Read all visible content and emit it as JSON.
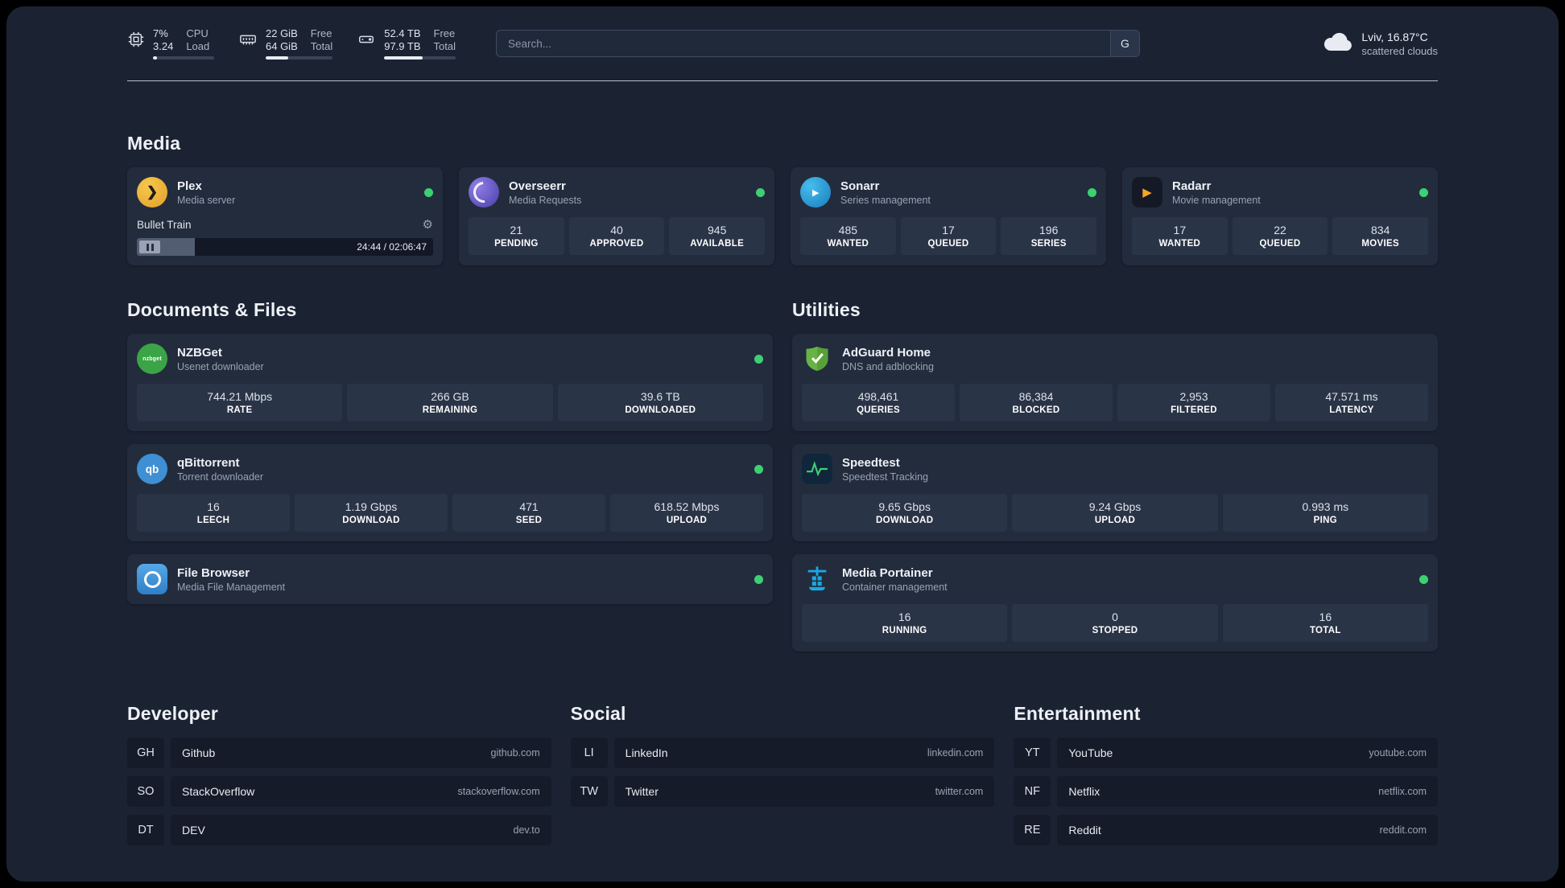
{
  "topbar": {
    "cpu": {
      "value_top": "7%",
      "value_bottom": "3.24",
      "label_top": "CPU",
      "label_bottom": "Load",
      "bar_percent": 7
    },
    "ram": {
      "value_top": "22 GiB",
      "value_bottom": "64 GiB",
      "label_top": "Free",
      "label_bottom": "Total",
      "bar_percent": 34
    },
    "disk": {
      "value_top": "52.4 TB",
      "value_bottom": "97.9 TB",
      "label_top": "Free",
      "label_bottom": "Total",
      "bar_percent": 54
    },
    "search": {
      "placeholder": "Search...",
      "engine_label": "G"
    },
    "weather": {
      "location": "Lviv, 16.87°C",
      "condition": "scattered clouds"
    }
  },
  "sections": {
    "media": {
      "title": "Media",
      "plex": {
        "name": "Plex",
        "subtitle": "Media server",
        "now_playing": {
          "title": "Bullet Train",
          "time": "24:44 / 02:06:47",
          "progress_percent": 19.5
        }
      },
      "overseerr": {
        "name": "Overseerr",
        "subtitle": "Media Requests",
        "stats": [
          {
            "value": "21",
            "label": "PENDING"
          },
          {
            "value": "40",
            "label": "APPROVED"
          },
          {
            "value": "945",
            "label": "AVAILABLE"
          }
        ]
      },
      "sonarr": {
        "name": "Sonarr",
        "subtitle": "Series management",
        "stats": [
          {
            "value": "485",
            "label": "WANTED"
          },
          {
            "value": "17",
            "label": "QUEUED"
          },
          {
            "value": "196",
            "label": "SERIES"
          }
        ]
      },
      "radarr": {
        "name": "Radarr",
        "subtitle": "Movie management",
        "stats": [
          {
            "value": "17",
            "label": "WANTED"
          },
          {
            "value": "22",
            "label": "QUEUED"
          },
          {
            "value": "834",
            "label": "MOVIES"
          }
        ]
      }
    },
    "documents": {
      "title": "Documents & Files",
      "nzbget": {
        "name": "NZBGet",
        "subtitle": "Usenet downloader",
        "icon_text": "nzbget",
        "stats": [
          {
            "value": "744.21 Mbps",
            "label": "RATE"
          },
          {
            "value": "266 GB",
            "label": "REMAINING"
          },
          {
            "value": "39.6 TB",
            "label": "DOWNLOADED"
          }
        ]
      },
      "qbittorrent": {
        "name": "qBittorrent",
        "subtitle": "Torrent downloader",
        "icon_text": "qb",
        "stats": [
          {
            "value": "16",
            "label": "LEECH"
          },
          {
            "value": "1.19 Gbps",
            "label": "DOWNLOAD"
          },
          {
            "value": "471",
            "label": "SEED"
          },
          {
            "value": "618.52 Mbps",
            "label": "UPLOAD"
          }
        ]
      },
      "filebrowser": {
        "name": "File Browser",
        "subtitle": "Media File Management"
      }
    },
    "utilities": {
      "title": "Utilities",
      "adguard": {
        "name": "AdGuard Home",
        "subtitle": "DNS and adblocking",
        "stats": [
          {
            "value": "498,461",
            "label": "QUERIES"
          },
          {
            "value": "86,384",
            "label": "BLOCKED"
          },
          {
            "value": "2,953",
            "label": "FILTERED"
          },
          {
            "value": "47.571 ms",
            "label": "LATENCY"
          }
        ]
      },
      "speedtest": {
        "name": "Speedtest",
        "subtitle": "Speedtest Tracking",
        "stats": [
          {
            "value": "9.65 Gbps",
            "label": "DOWNLOAD"
          },
          {
            "value": "9.24 Gbps",
            "label": "UPLOAD"
          },
          {
            "value": "0.993 ms",
            "label": "PING"
          }
        ]
      },
      "portainer": {
        "name": "Media Portainer",
        "subtitle": "Container management",
        "stats": [
          {
            "value": "16",
            "label": "RUNNING"
          },
          {
            "value": "0",
            "label": "STOPPED"
          },
          {
            "value": "16",
            "label": "TOTAL"
          }
        ]
      }
    },
    "bookmarks": [
      {
        "title": "Developer",
        "items": [
          {
            "abbr": "GH",
            "name": "Github",
            "url": "github.com"
          },
          {
            "abbr": "SO",
            "name": "StackOverflow",
            "url": "stackoverflow.com"
          },
          {
            "abbr": "DT",
            "name": "DEV",
            "url": "dev.to"
          }
        ]
      },
      {
        "title": "Social",
        "items": [
          {
            "abbr": "LI",
            "name": "LinkedIn",
            "url": "linkedin.com"
          },
          {
            "abbr": "TW",
            "name": "Twitter",
            "url": "twitter.com"
          }
        ]
      },
      {
        "title": "Entertainment",
        "items": [
          {
            "abbr": "YT",
            "name": "YouTube",
            "url": "youtube.com"
          },
          {
            "abbr": "NF",
            "name": "Netflix",
            "url": "netflix.com"
          },
          {
            "abbr": "RE",
            "name": "Reddit",
            "url": "reddit.com"
          }
        ]
      }
    ]
  },
  "colors": {
    "accent_green": "#3dd073"
  }
}
